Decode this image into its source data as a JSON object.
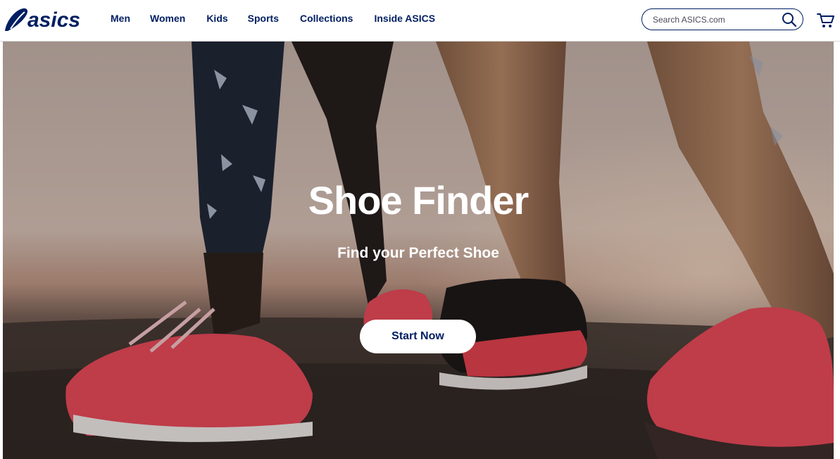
{
  "header": {
    "logo_text": "asics",
    "nav": [
      {
        "label": "Men"
      },
      {
        "label": "Women"
      },
      {
        "label": "Kids"
      },
      {
        "label": "Sports"
      },
      {
        "label": "Collections"
      },
      {
        "label": "Inside ASICS"
      }
    ],
    "search": {
      "placeholder": "Search ASICS.com",
      "value": ""
    },
    "icons": {
      "search": "search-icon",
      "cart": "cart-icon"
    }
  },
  "hero": {
    "title": "Shoe Finder",
    "subtitle": "Find your Perfect Shoe",
    "cta_label": "Start Now"
  },
  "colors": {
    "brand_navy": "#001e62",
    "shoe_coral": "#f0495a",
    "white": "#ffffff"
  }
}
